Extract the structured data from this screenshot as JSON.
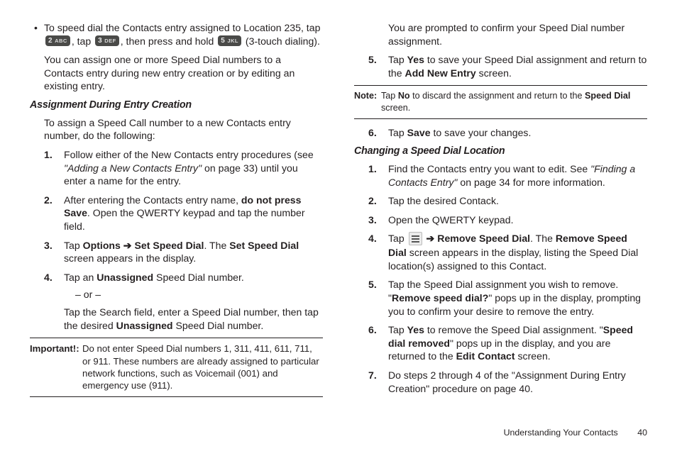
{
  "left": {
    "bullet1_a": "To speed dial the Contacts entry assigned to Location 235, tap ",
    "bullet1_b": ", tap ",
    "bullet1_c": ", then press and hold ",
    "bullet1_d": " (3-touch dialing).",
    "key2_n": "2",
    "key2_s": "ABC",
    "key3_n": "3",
    "key3_s": "DEF",
    "key5_n": "5",
    "key5_s": "JKL",
    "intro2": "You can assign one or more Speed Dial numbers to a Contacts entry during new entry creation or by editing an existing entry.",
    "h3a": "Assignment During Entry Creation",
    "intro3": "To assign a Speed Call number to a new Contacts entry number, do the following:",
    "s1_a": "Follow either of the New Contacts entry procedures (see ",
    "s1_b": "\"Adding a New Contacts Entry\"",
    "s1_c": " on page 33) until you enter a name for the entry.",
    "s2_a": "After entering the Contacts entry name, ",
    "s2_b": "do not press Save",
    "s2_c": ". Open the QWERTY keypad and tap the number field.",
    "s3_a": "Tap ",
    "s3_b": "Options ",
    "s3_arrow": "➔",
    "s3_c": " Set Speed Dial",
    "s3_d": ". The ",
    "s3_e": "Set Speed Dial",
    "s3_f": " screen appears in the display.",
    "s4_a": "Tap an ",
    "s4_b": "Unassigned",
    "s4_c": " Speed Dial number.",
    "s4_or": "– or –",
    "s4_alt_a": "Tap the Search field, enter a Speed Dial number, then tap the desired ",
    "s4_alt_b": "Unassigned",
    "s4_alt_c": " Speed Dial number.",
    "imp_tag": "Important!:",
    "imp_body": "Do not enter Speed Dial numbers 1, 311, 411, 611, 711, or 911. These numbers are already assigned to particular network functions, such as Voicemail (001) and emergency use (911)."
  },
  "right": {
    "cont4": "You are prompted to confirm your Speed Dial number assignment.",
    "s5_a": "Tap ",
    "s5_b": "Yes",
    "s5_c": " to save your Speed Dial assignment and return to the ",
    "s5_d": "Add New Entry",
    "s5_e": " screen.",
    "note_tag": "Note:",
    "note_a": "Tap ",
    "note_b": "No",
    "note_c": " to discard the assignment and return to the ",
    "note_d": "Speed Dial",
    "note_e": " screen.",
    "s6_a": "Tap ",
    "s6_b": "Save",
    "s6_c": " to save your changes.",
    "h3b": "Changing a Speed Dial Location",
    "c1_a": "Find the Contacts entry you want to edit. See ",
    "c1_b": "\"Finding a Contacts Entry\"",
    "c1_c": " on page 34 for more information.",
    "c2": "Tap the desired Contack.",
    "c3": "Open the QWERTY keypad.",
    "c4_a": "Tap ",
    "c4_arrow": " ➔ ",
    "c4_b": "Remove Speed Dial",
    "c4_c": ". The ",
    "c4_d": "Remove Speed Dial",
    "c4_e": " screen appears in the display, listing the Speed Dial location(s) assigned to this Contact.",
    "c5_a": "Tap the Speed Dial assignment you wish to remove. \"",
    "c5_b": "Remove speed dial?",
    "c5_c": "\" pops up in the display, prompting you to confirm your desire to remove the entry.",
    "c6_a": "Tap ",
    "c6_b": "Yes",
    "c6_c": " to remove the Speed Dial assignment. \"",
    "c6_d": "Speed dial removed",
    "c6_e": "\" pops up in the display, and you are returned to the ",
    "c6_f": "Edit Contact",
    "c6_g": " screen.",
    "c7": "Do steps 2 through 4 of the \"Assignment During Entry Creation\" procedure on page 40."
  },
  "footer": {
    "section": "Understanding Your Contacts",
    "page": "40"
  }
}
